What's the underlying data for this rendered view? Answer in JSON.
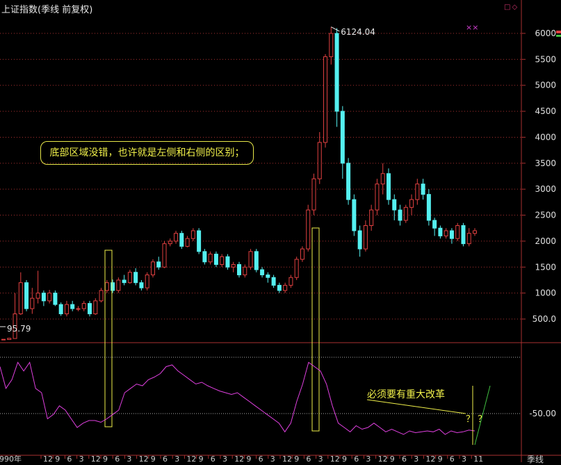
{
  "app": {
    "title": "上证指数(季线 前复权)",
    "icons": [
      "square-icon",
      "diamond-icon"
    ],
    "colors": {
      "background": "#000000",
      "up": "#e04040",
      "down": "#54f0f0",
      "grid": "#a83030",
      "indicator": "#e040e0",
      "annotation": "#f0f04a"
    }
  },
  "annotations": {
    "box_text": "底部区域没错，也许就是左侧和右侧的区别；",
    "reform_text": "必须要有重大改革",
    "question_marks": "？ ？",
    "peak_label": "6124.04",
    "low_label": "95.79",
    "pink_marks": "××"
  },
  "right_axis": {
    "price_ticks": [
      "6000",
      "5500",
      "5000",
      "4500",
      "4000",
      "3500",
      "3000",
      "2500",
      "2000",
      "1500",
      "1000",
      "500.0"
    ],
    "indicator_tick": "-50.00",
    "bottom_label": "季线"
  },
  "bottom_axis": {
    "year_label": "1990年",
    "ticks": [
      "12",
      "9",
      "6",
      "3",
      "12",
      "9",
      "6",
      "3",
      "12",
      "9",
      "6",
      "3",
      "12",
      "9",
      "6",
      "3",
      "12",
      "9",
      "6",
      "3",
      "12",
      "9",
      "6",
      "3",
      "12",
      "9",
      "6",
      "3",
      "12",
      "9",
      "6",
      "3",
      "12",
      "9",
      "6",
      "3",
      "11"
    ]
  },
  "chart_data": {
    "type": "candlestick",
    "title": "上证指数(季线 前复权)",
    "ylim": [
      0,
      6400
    ],
    "peak": 6124.04,
    "low": 95.79,
    "candles": [
      [
        100,
        110,
        96,
        105
      ],
      [
        105,
        130,
        100,
        125
      ],
      [
        125,
        600,
        120,
        1000
      ],
      [
        600,
        1200,
        580,
        1400
      ],
      [
        1200,
        700,
        650,
        1250
      ],
      [
        700,
        900,
        600,
        1100
      ],
      [
        900,
        1000,
        800,
        1430
      ],
      [
        1000,
        850,
        750,
        1050
      ],
      [
        850,
        1000,
        800,
        1060
      ],
      [
        1000,
        780,
        750,
        1050
      ],
      [
        780,
        600,
        560,
        820
      ],
      [
        600,
        780,
        550,
        850
      ],
      [
        780,
        700,
        650,
        850
      ],
      [
        700,
        700,
        650,
        750
      ],
      [
        700,
        800,
        650,
        850
      ],
      [
        800,
        600,
        550,
        850
      ],
      [
        600,
        850,
        580,
        900
      ],
      [
        850,
        1050,
        820,
        1100
      ],
      [
        1050,
        1200,
        1000,
        1250
      ],
      [
        1200,
        1050,
        1000,
        1260
      ],
      [
        1050,
        1250,
        1000,
        1300
      ],
      [
        1250,
        1200,
        1150,
        1350
      ],
      [
        1200,
        1400,
        1180,
        1450
      ],
      [
        1400,
        1200,
        1150,
        1480
      ],
      [
        1200,
        1100,
        1050,
        1250
      ],
      [
        1100,
        1350,
        1050,
        1400
      ],
      [
        1350,
        1600,
        1300,
        1650
      ],
      [
        1600,
        1500,
        1450,
        1700
      ],
      [
        1500,
        1950,
        1480,
        2000
      ],
      [
        1950,
        2000,
        1900,
        2050
      ],
      [
        2000,
        2150,
        1950,
        2200
      ],
      [
        2150,
        1900,
        1850,
        2200
      ],
      [
        1900,
        2050,
        1880,
        2100
      ],
      [
        2050,
        2200,
        2000,
        2250
      ],
      [
        2200,
        1800,
        1750,
        2250
      ],
      [
        1800,
        1600,
        1550,
        1850
      ],
      [
        1600,
        1750,
        1550,
        1800
      ],
      [
        1750,
        1550,
        1500,
        1800
      ],
      [
        1550,
        1700,
        1500,
        1750
      ],
      [
        1700,
        1500,
        1450,
        1750
      ],
      [
        1500,
        1550,
        1400,
        1600
      ],
      [
        1550,
        1350,
        1300,
        1600
      ],
      [
        1350,
        1500,
        1300,
        1550
      ],
      [
        1500,
        1800,
        1450,
        1850
      ],
      [
        1800,
        1450,
        1400,
        1850
      ],
      [
        1450,
        1350,
        1300,
        1500
      ],
      [
        1350,
        1300,
        1200,
        1400
      ],
      [
        1300,
        1150,
        1100,
        1350
      ],
      [
        1150,
        1050,
        1000,
        1200
      ],
      [
        1050,
        1150,
        1000,
        1200
      ],
      [
        1150,
        1300,
        1100,
        1350
      ],
      [
        1300,
        1650,
        1250,
        1700
      ],
      [
        1650,
        1850,
        1600,
        1900
      ],
      [
        1850,
        2600,
        1800,
        2700
      ],
      [
        2600,
        3200,
        2500,
        3300
      ],
      [
        3200,
        3900,
        3100,
        4100
      ],
      [
        3900,
        5550,
        3800,
        5600
      ],
      [
        5550,
        6000,
        5400,
        6124
      ],
      [
        6000,
        4500,
        4200,
        6100
      ],
      [
        4500,
        3500,
        3200,
        4600
      ],
      [
        3500,
        2800,
        2700,
        3600
      ],
      [
        2800,
        2200,
        2100,
        2900
      ],
      [
        2200,
        1850,
        1700,
        2300
      ],
      [
        1850,
        2300,
        1800,
        2400
      ],
      [
        2300,
        2600,
        2200,
        2700
      ],
      [
        2600,
        3100,
        2500,
        3200
      ],
      [
        3100,
        3300,
        2900,
        3500
      ],
      [
        3300,
        2800,
        2700,
        3400
      ],
      [
        2800,
        2600,
        2400,
        2900
      ],
      [
        2600,
        2400,
        2300,
        2700
      ],
      [
        2400,
        2650,
        2350,
        2700
      ],
      [
        2650,
        2800,
        2500,
        2900
      ],
      [
        2800,
        3100,
        2700,
        3200
      ],
      [
        3100,
        2900,
        2800,
        3200
      ],
      [
        2900,
        2400,
        2300,
        3000
      ],
      [
        2400,
        2250,
        2100,
        2450
      ],
      [
        2250,
        2100,
        2050,
        2300
      ],
      [
        2100,
        2200,
        2050,
        2250
      ],
      [
        2200,
        2050,
        1950,
        2250
      ],
      [
        2050,
        2300,
        2000,
        2350
      ],
      [
        2300,
        1950,
        1900,
        2350
      ],
      [
        1950,
        2150,
        1900,
        2250
      ],
      [
        2150,
        2200,
        2100,
        2250
      ]
    ],
    "indicator": {
      "name": "",
      "reference_line": -50,
      "values": [
        -10,
        -35,
        -25,
        -5,
        -15,
        -5,
        -35,
        -40,
        -70,
        -65,
        -55,
        -60,
        -70,
        -80,
        -75,
        -72,
        -72,
        -74,
        -70,
        -65,
        -60,
        -40,
        -35,
        -30,
        -32,
        -25,
        -22,
        -18,
        -10,
        -8,
        -15,
        -20,
        -25,
        -30,
        -28,
        -32,
        -35,
        -38,
        -40,
        -42,
        -40,
        -45,
        -50,
        -55,
        -60,
        -65,
        -70,
        -75,
        -85,
        -75,
        -50,
        -30,
        -5,
        -10,
        -15,
        -30,
        -55,
        -75,
        -80,
        -85,
        -78,
        -82,
        -80,
        -75,
        -80,
        -85,
        -82,
        -85,
        -88,
        -84,
        -86,
        -85,
        -84,
        -85,
        -82,
        -88,
        -84,
        -86,
        -85,
        -83,
        -84
      ]
    }
  }
}
